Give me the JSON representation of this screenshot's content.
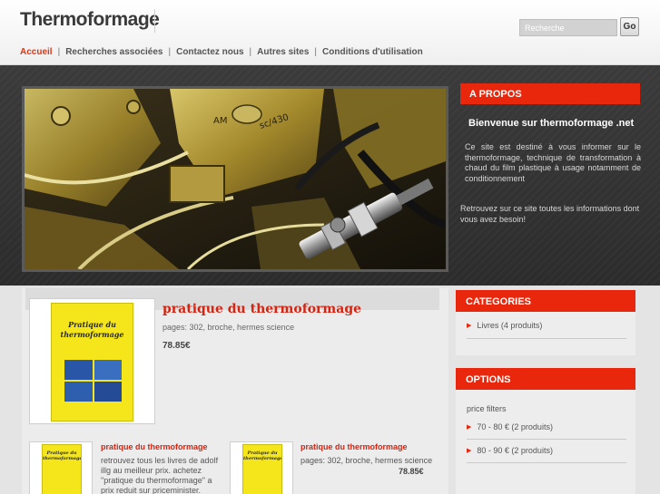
{
  "site": {
    "title": "Thermoformage"
  },
  "search": {
    "placeholder": "Recherche",
    "button_label": "Go"
  },
  "nav": {
    "items": [
      {
        "label": "Accueil",
        "active": true
      },
      {
        "label": "Recherches associées"
      },
      {
        "label": "Contactez nous"
      },
      {
        "label": "Autres sites"
      },
      {
        "label": "Conditions d'utilisation"
      }
    ],
    "separator": "|"
  },
  "about": {
    "heading": "A PROPOS",
    "title": "Bienvenue sur thermoformage .net",
    "paragraph1": "Ce site est destiné à vous informer sur le thermoformage, technique de transformation à chaud du film plastique à usage notamment de conditionnement",
    "paragraph2": "Retrouvez sur ce site toutes les informations dont vous avez besoin!"
  },
  "hero_photo": {
    "stamp_text": "AM",
    "stamp_code": "sc/430"
  },
  "featured": {
    "title": "pratique du thermoformage",
    "meta": "pages: 302, broche, hermes science",
    "price": "78.85€",
    "cover_title": "Pratique du thermoformage"
  },
  "small_items": [
    {
      "title": "pratique du thermoformage",
      "text": "retrouvez tous les livres de adolf illg au meilleur prix. achetez \"pratique du thermoformage\" a prix reduit sur priceminister.",
      "price": ""
    },
    {
      "title": "pratique du thermoformage",
      "text": "pages: 302, broche, hermes science",
      "price": "78.85€"
    }
  ],
  "categories": {
    "heading": "CATEGORIES",
    "items": [
      {
        "label": "Livres (4 produits)"
      }
    ]
  },
  "options": {
    "heading": "OPTIONS",
    "filter_label": "price filters",
    "items": [
      {
        "label": "70 - 80 € (2 produits)"
      },
      {
        "label": "80 - 90 € (2 produits)"
      }
    ]
  },
  "colors": {
    "accent": "#e8270c",
    "title_red": "#d72310",
    "dark_band": "#333333"
  }
}
